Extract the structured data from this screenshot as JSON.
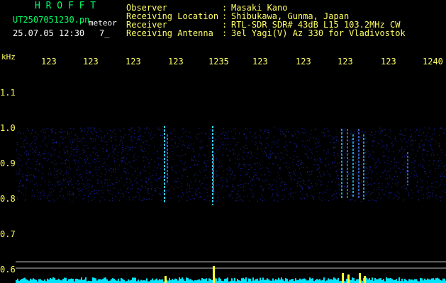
{
  "header": {
    "brand": "H R O F F T",
    "filename": "UT2507051230.pn",
    "meteor_label": "meteor",
    "datetime": "25.07.05 12:30",
    "count": "7_"
  },
  "info": {
    "labels": [
      "Observer",
      "Receiving Location",
      "Receiver",
      "Receiving Antenna"
    ],
    "separators": [
      ":",
      ":",
      ":",
      ":"
    ],
    "values": [
      "Masaki Kano",
      "Shibukawa, Gunma, Japan",
      "RTL-SDR SDR# 43dB L15 103.2MHz CW",
      "3el Yagi(V) Az 330 for Vladivostok"
    ]
  },
  "axis": {
    "unit": "kHz",
    "x_ticks": [
      "123",
      "123",
      "123",
      "123",
      "1235",
      "123",
      "123",
      "123",
      "123",
      "1240"
    ],
    "y_ticks": [
      "1.1",
      "1.0",
      "0.9",
      "0.8",
      "0.7",
      "0.6"
    ]
  },
  "colors": {
    "header_green": "#00ff66",
    "label_yellow": "#ffff66",
    "noise_blue": "#1a2a8c",
    "echo_cyan": "#33ccff",
    "echo_red": "#ff3366",
    "baseline_cyan": "#00e5ff"
  }
}
